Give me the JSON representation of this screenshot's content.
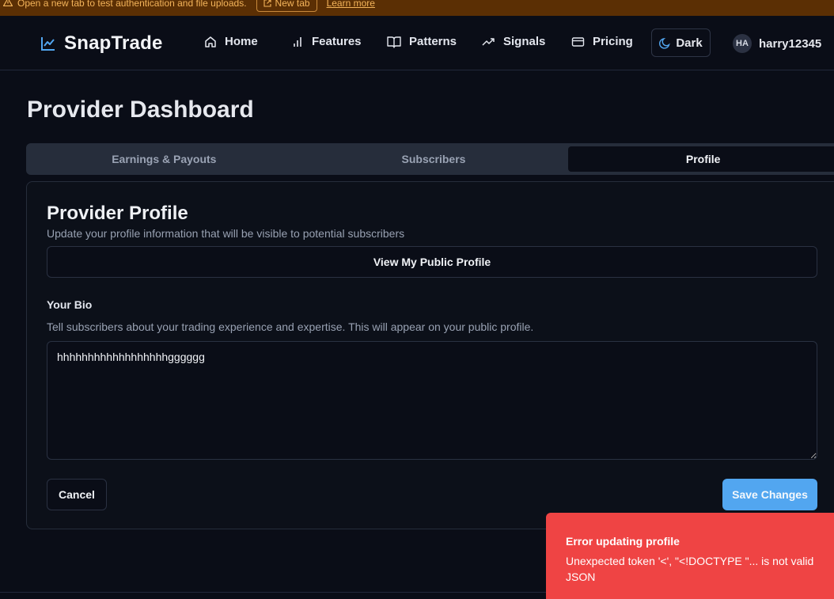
{
  "banner": {
    "text": "Open a new tab to test authentication and file uploads.",
    "new_tab": "New tab",
    "learn_more": "Learn more"
  },
  "nav": {
    "brand": "SnapTrade",
    "items": [
      {
        "label": "Home",
        "icon": "home-icon"
      },
      {
        "label": "Features",
        "icon": "bar-chart-icon"
      },
      {
        "label": "Patterns",
        "icon": "book-icon"
      },
      {
        "label": "Signals",
        "icon": "trending-up-icon"
      },
      {
        "label": "Pricing",
        "icon": "credit-card-icon"
      }
    ],
    "theme_label": "Dark",
    "user": {
      "initials": "HA",
      "name": "harry12345"
    }
  },
  "page": {
    "title": "Provider Dashboard"
  },
  "tabs": [
    {
      "label": "Earnings & Payouts",
      "active": false
    },
    {
      "label": "Subscribers",
      "active": false
    },
    {
      "label": "Profile",
      "active": true
    }
  ],
  "profile": {
    "title": "Provider Profile",
    "subtitle": "Update your profile information that will be visible to potential subscribers",
    "view_public": "View My Public Profile",
    "bio_label": "Your Bio",
    "bio_help": "Tell subscribers about your trading experience and expertise. This will appear on your public profile.",
    "bio_value": "hhhhhhhhhhhhhhhhhhgggggg",
    "cancel": "Cancel",
    "save": "Save Changes"
  },
  "toast": {
    "title": "Error updating profile",
    "message": "Unexpected token '<', \"<!DOCTYPE \"... is not valid JSON"
  },
  "colors": {
    "background": "#0a0d17",
    "accent": "#52a6f0",
    "error": "#ef4444",
    "banner": "#5b2f04"
  }
}
